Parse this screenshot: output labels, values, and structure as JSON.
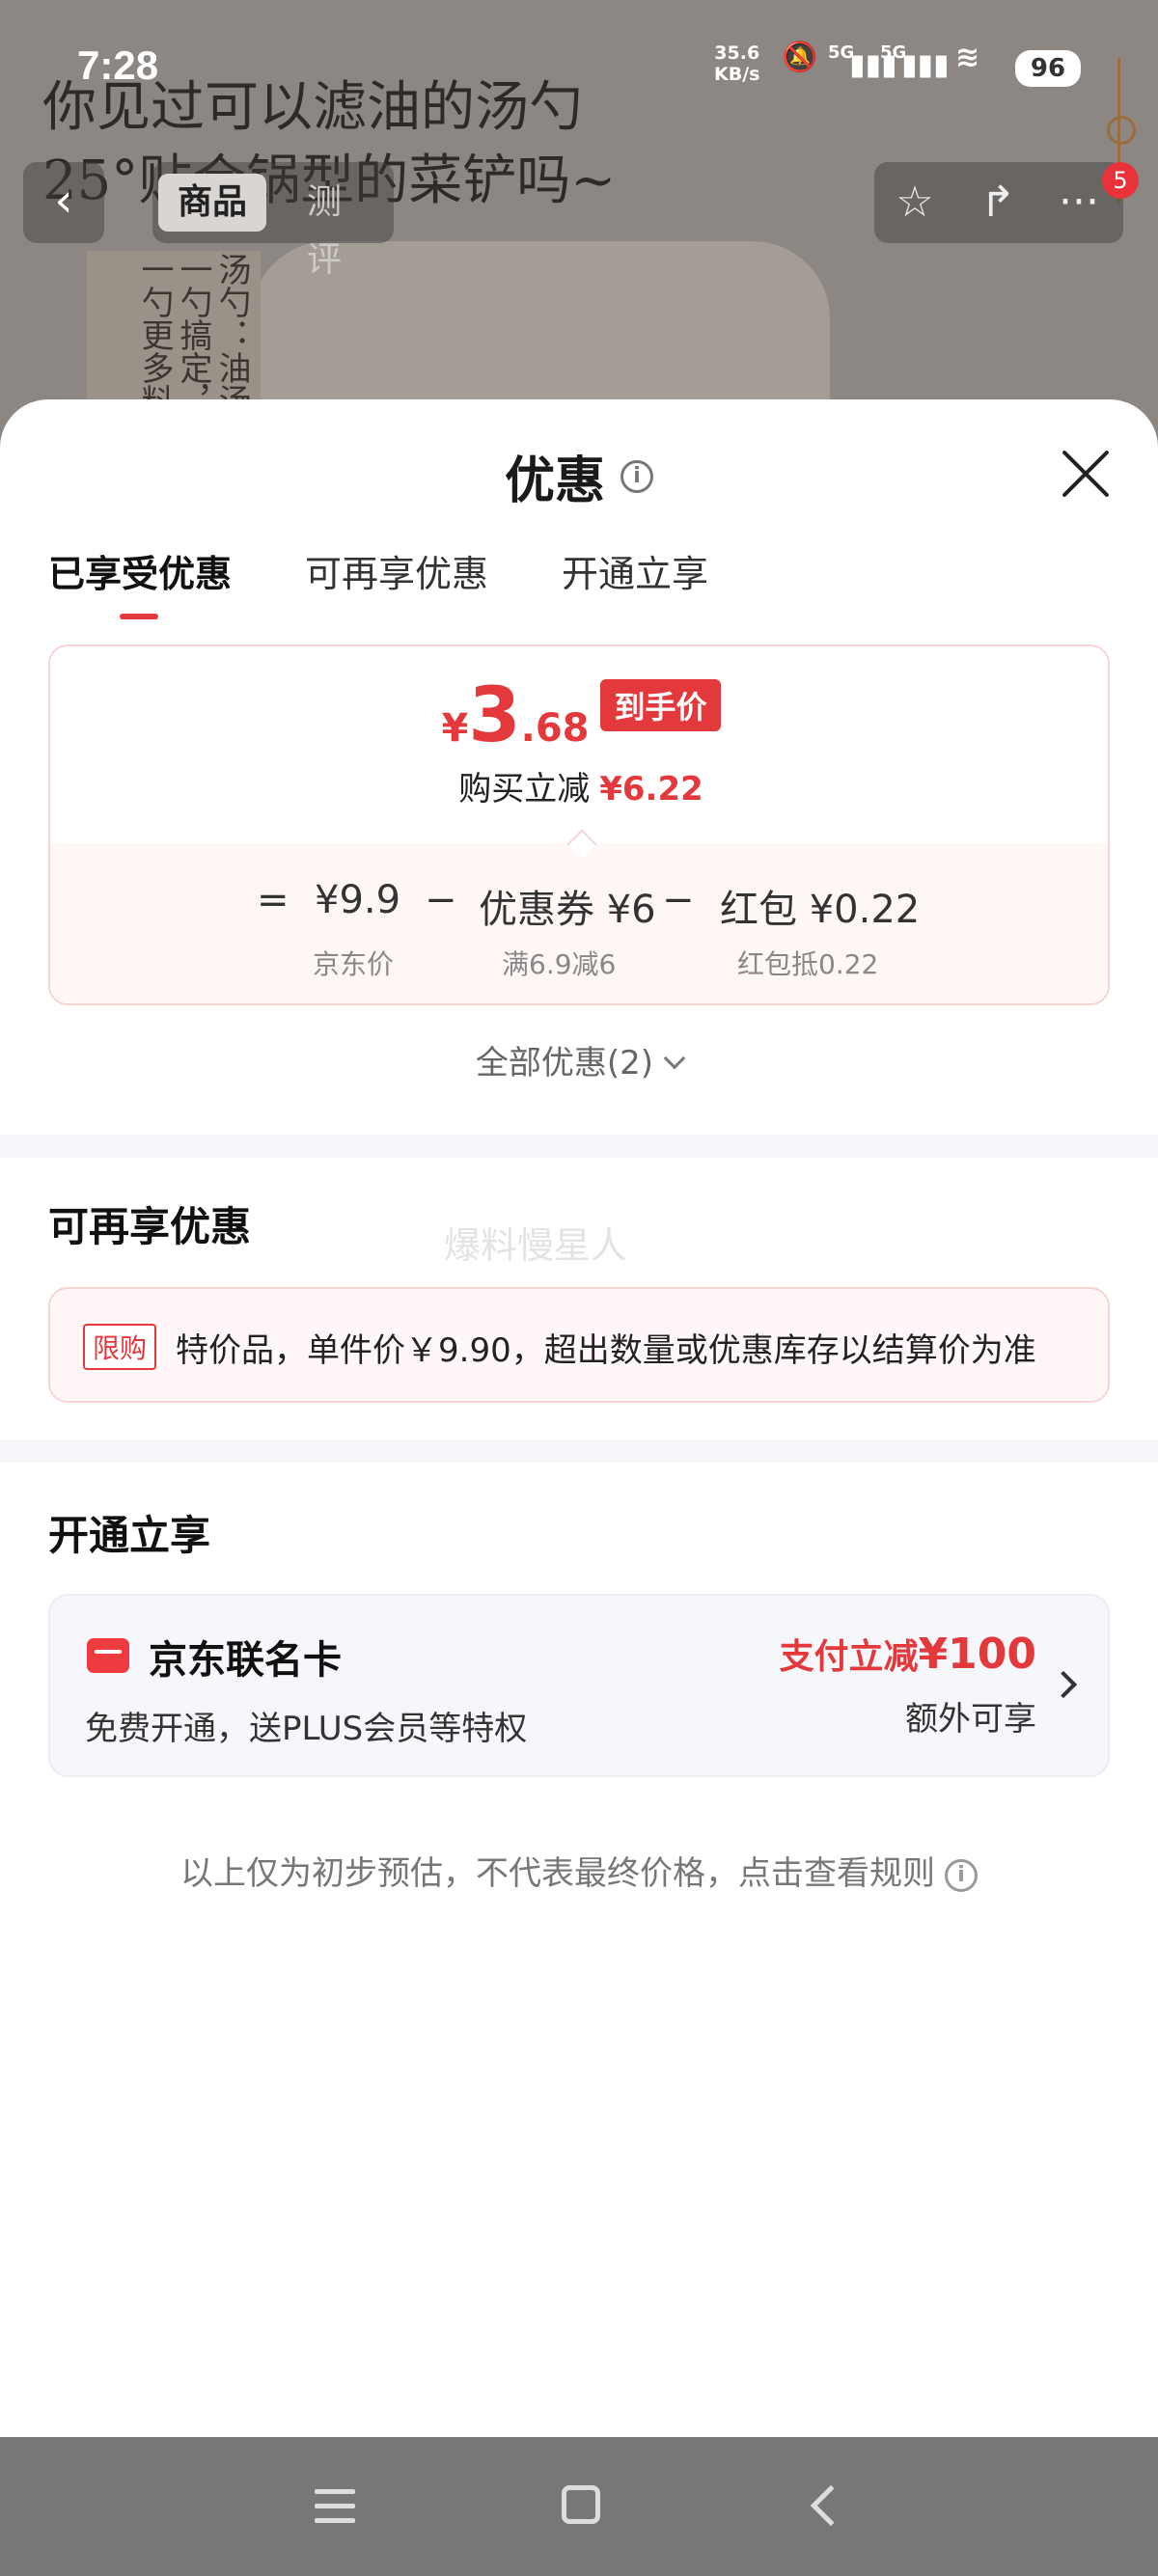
{
  "status_bar": {
    "time": "7:28",
    "net_speed_value": "35.6",
    "net_speed_unit": "KB/s",
    "signal1": "5G",
    "signal2": "5G",
    "battery": "96"
  },
  "background": {
    "headline_line1": "你见过可以滤油的汤勺",
    "headline_line2": "25°贴合锅型的菜铲吗~",
    "vertical_text": "汤勺：油汤一勺搞定，一勺更多料"
  },
  "top_nav": {
    "tabs": [
      {
        "label": "商品",
        "active": true
      },
      {
        "label": "测评",
        "active": false
      }
    ],
    "badge_count": "5"
  },
  "sheet": {
    "title": "优惠",
    "tabs": [
      {
        "label": "已享受优惠",
        "active": true
      },
      {
        "label": "可再享优惠",
        "active": false
      },
      {
        "label": "开通立享",
        "active": false
      }
    ],
    "final_price": {
      "currency": "¥",
      "integer": "3",
      "decimal": ".68",
      "tag": "到手价"
    },
    "savings": {
      "label": "购买立减",
      "amount": "¥6.22"
    },
    "formula": {
      "equals": "=",
      "minus": "−",
      "jd_price": "¥9.9",
      "jd_price_label": "京东价",
      "coupon": "优惠券 ¥6",
      "coupon_detail": "满6.9减6",
      "redpacket": "红包 ¥0.22",
      "redpacket_detail": "红包抵0.22"
    },
    "all_deals": "全部优惠(2)",
    "watermark": "爆料慢星人",
    "more_section": {
      "title": "可再享优惠",
      "tag": "限购",
      "text": "特价品，单件价￥9.90，超出数量或优惠库存以结算价为准"
    },
    "open_section": {
      "title": "开通立享",
      "card_name": "京东联名卡",
      "card_desc": "免费开通，送PLUS会员等特权",
      "promo_label": "支付立减",
      "promo_amount": "¥100",
      "promo_extra": "额外可享"
    },
    "disclaimer": "以上仅为初步预估，不代表最终价格，点击查看规则"
  },
  "colors": {
    "accent": "#e4393c",
    "sheet_bg": "#ffffff",
    "separator": "#f5f6fa"
  },
  "icons": [
    "back-icon",
    "star-icon",
    "share-icon",
    "more-icon",
    "info-icon",
    "close-icon",
    "chevron-down-icon",
    "card-icon",
    "chevron-right-icon",
    "menu-icon",
    "home-icon",
    "nav-back-icon"
  ]
}
